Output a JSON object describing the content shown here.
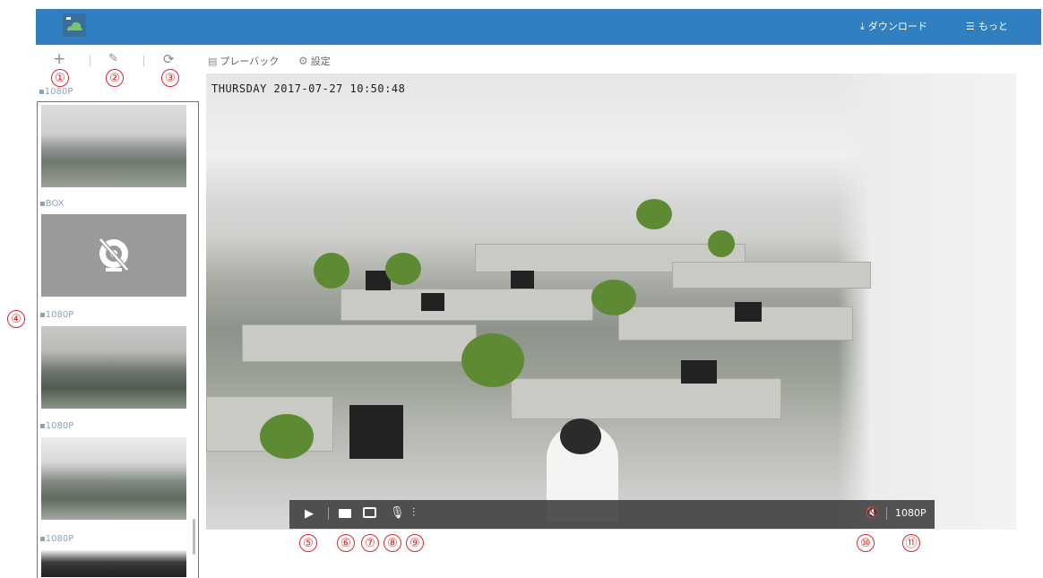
{
  "header": {
    "download_label": "ダウンロード",
    "more_label": "もっと",
    "bar_color": "#2f7fc1"
  },
  "toolbar": {
    "add_icon": "plus-icon",
    "edit_icon": "edit-icon",
    "refresh_icon": "refresh-icon",
    "playback_label": "プレーバック",
    "settings_label": "設定"
  },
  "callouts": {
    "n1": "①",
    "n2": "②",
    "n3": "③",
    "n4": "④",
    "n5": "⑤",
    "n6": "⑥",
    "n7": "⑦",
    "n8": "⑧",
    "n9": "⑨",
    "n10": "⑩",
    "n11": "⑪"
  },
  "sidebar": {
    "cameras": [
      {
        "label": "1080P",
        "status": "online"
      },
      {
        "label": "BOX",
        "status": "offline"
      },
      {
        "label": "1080P",
        "status": "online"
      },
      {
        "label": "1080P",
        "status": "online"
      },
      {
        "label": "1080P",
        "status": "online"
      }
    ]
  },
  "video": {
    "timestamp": "THURSDAY 2017-07-27 10:50:48",
    "resolution": "1080P"
  },
  "controls": {
    "icons": [
      "play-icon",
      "record-icon",
      "snapshot-icon",
      "microphone-icon",
      "adjust-icon",
      "mute-icon"
    ]
  },
  "colors": {
    "callout": "#d9282b",
    "sidebar_border": "#e04848"
  }
}
